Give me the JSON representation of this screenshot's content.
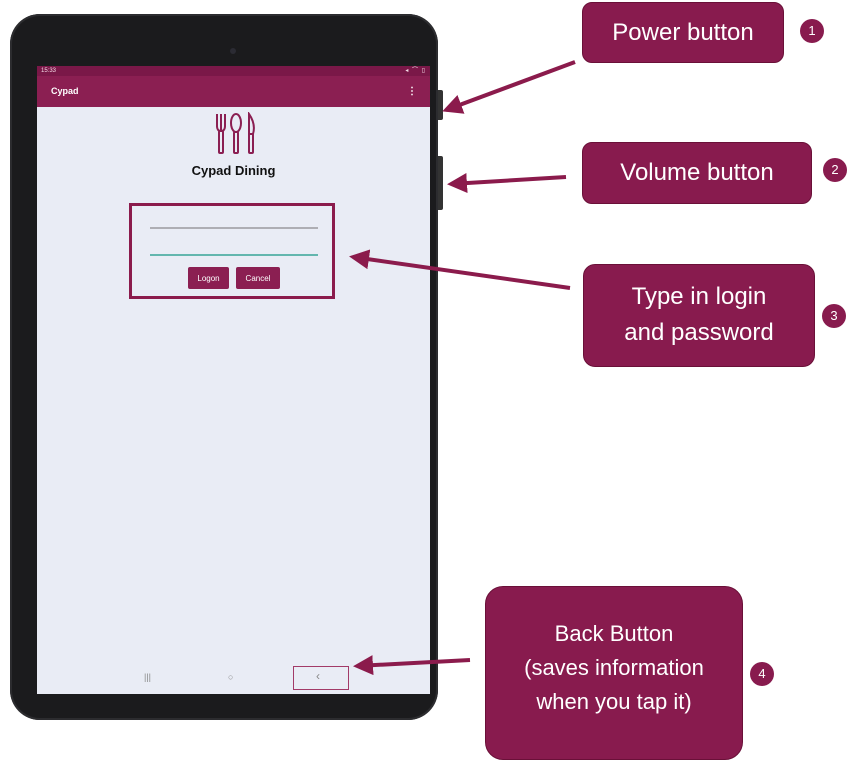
{
  "app": {
    "status_time": "15:33",
    "status_right": "◂ ⌒ ▯",
    "title": "Cypad",
    "menu_icon": "⋮",
    "name": "Cypad Dining",
    "logon_label": "Logon",
    "cancel_label": "Cancel",
    "nav": {
      "recent": "|||",
      "home": "○",
      "back": "‹"
    }
  },
  "callouts": [
    {
      "number": "1",
      "lines": [
        "Power button"
      ]
    },
    {
      "number": "2",
      "lines": [
        "Volume button"
      ]
    },
    {
      "number": "3",
      "lines": [
        "Type in login",
        "and password"
      ]
    },
    {
      "number": "4",
      "lines": [
        "Back Button",
        "(saves information",
        "when you tap it)"
      ]
    }
  ],
  "colors": {
    "accent": "#881b4e",
    "appbar": "#8b1f52",
    "screen": "#e9ecf5",
    "tablet_body": "#1b1b1d",
    "arrow": "#8b1b4c"
  },
  "icons": [
    "fork-knife-spoon-logo",
    "kebab-menu-icon",
    "recent-apps-icon",
    "home-icon",
    "back-icon"
  ]
}
